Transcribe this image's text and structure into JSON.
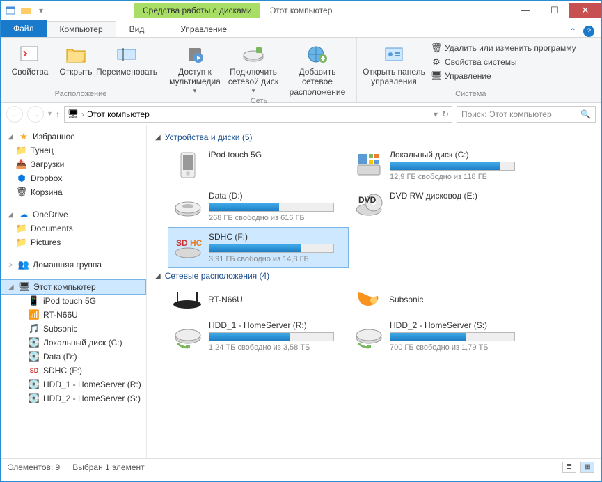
{
  "window": {
    "context_tab": "Средства работы с дисками",
    "title": "Этот компьютер"
  },
  "tabs": {
    "file": "Файл",
    "computer": "Компьютер",
    "view": "Вид",
    "manage": "Управление"
  },
  "ribbon": {
    "location": {
      "label": "Расположение",
      "properties": "Свойства",
      "open": "Открыть",
      "rename": "Переименовать"
    },
    "network": {
      "label": "Сеть",
      "media": "Доступ к мультимедиа",
      "map": "Подключить сетевой диск",
      "add": "Добавить сетевое расположение"
    },
    "system": {
      "label": "Система",
      "controlpanel": "Открыть панель управления",
      "uninstall": "Удалить или изменить программу",
      "sysprops": "Свойства системы",
      "manage": "Управление"
    }
  },
  "location": "Этот компьютер",
  "search_placeholder": "Поиск: Этот компьютер",
  "tree": {
    "favorites": "Избранное",
    "fav_items": [
      "Тунец",
      "Загрузки",
      "Dropbox",
      "Корзина"
    ],
    "onedrive": "OneDrive",
    "od_items": [
      "Documents",
      "Pictures"
    ],
    "homegroup": "Домашняя группа",
    "thispc": "Этот компьютер",
    "pc_items": [
      "iPod touch 5G",
      "RT-N66U",
      "Subsonic",
      "Локальный диск (C:)",
      "Data (D:)",
      "SDHC (F:)",
      "HDD_1 - HomeServer (R:)",
      "HDD_2 - HomeServer (S:)"
    ]
  },
  "sections": {
    "drives": "Устройства и диски (5)",
    "network": "Сетевые расположения (4)"
  },
  "drives": [
    {
      "name": "iPod touch 5G",
      "free": "",
      "pct": 0,
      "icon": "ipod"
    },
    {
      "name": "Локальный диск (C:)",
      "free": "12,9 ГБ свободно из 118 ГБ",
      "pct": 89,
      "icon": "windisk"
    },
    {
      "name": "Data (D:)",
      "free": "268 ГБ свободно из 616 ГБ",
      "pct": 56,
      "icon": "disk"
    },
    {
      "name": "DVD RW дисковод (E:)",
      "free": "",
      "pct": 0,
      "icon": "dvd"
    },
    {
      "name": "SDHC (F:)",
      "free": "3,91 ГБ свободно из 14,8 ГБ",
      "pct": 74,
      "icon": "sdhc",
      "selected": true
    }
  ],
  "netloc": [
    {
      "name": "RT-N66U",
      "icon": "router"
    },
    {
      "name": "Subsonic",
      "icon": "media"
    },
    {
      "name": "HDD_1 - HomeServer (R:)",
      "free": "1,24 ТБ свободно из 3,58 ТБ",
      "pct": 65,
      "icon": "netdisk"
    },
    {
      "name": "HDD_2 - HomeServer (S:)",
      "free": "700 ГБ свободно из 1,79 ТБ",
      "pct": 61,
      "icon": "netdisk"
    }
  ],
  "status": {
    "items": "Элементов: 9",
    "selected": "Выбран 1 элемент"
  }
}
